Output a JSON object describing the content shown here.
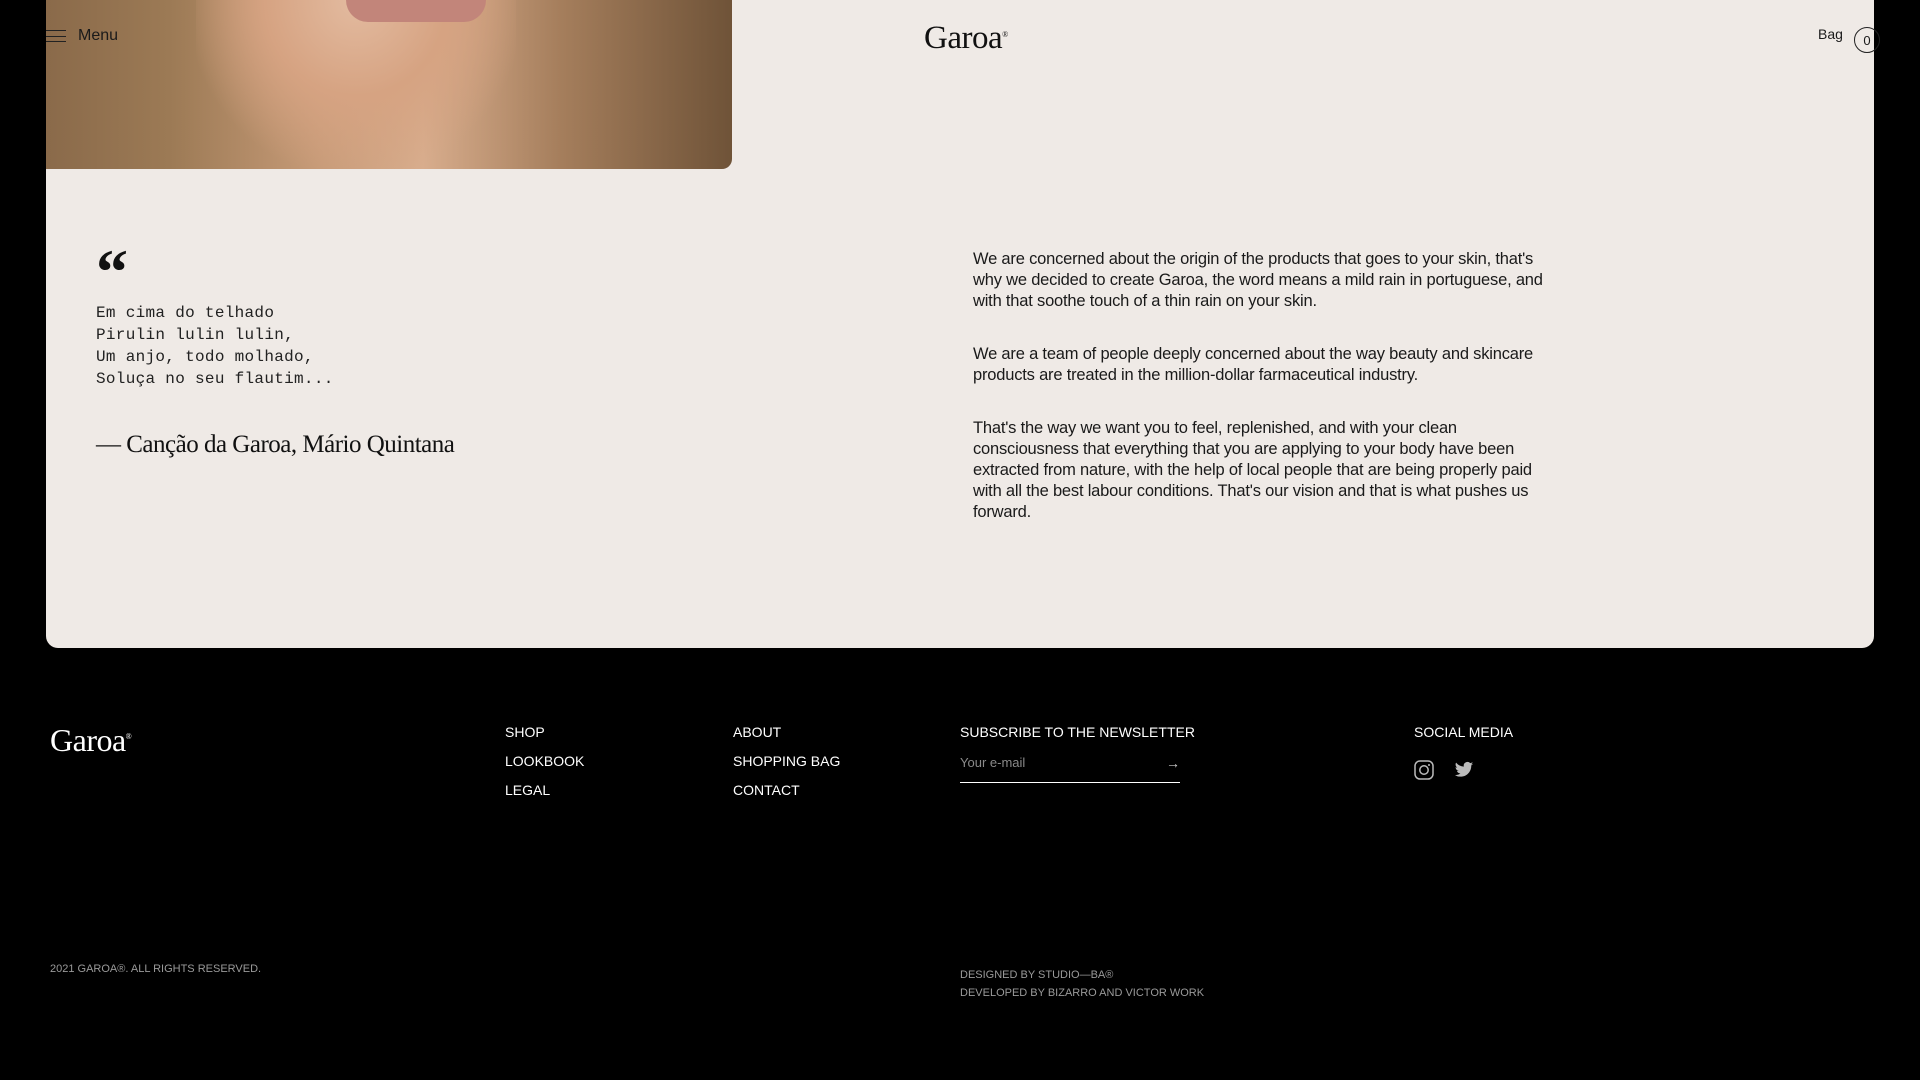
{
  "header": {
    "menu_label": "Menu",
    "logo": "Garoa",
    "logo_mark": "®",
    "bag_label": "Bag",
    "bag_count": "0"
  },
  "quote": {
    "mark": "“",
    "lines": [
      "Em cima do telhado",
      "Pirulin lulin lulin,",
      "Um anjo, todo molhado,",
      "Soluça no seu flautim..."
    ],
    "attribution": "— Canção da Garoa, Mário Quintana"
  },
  "about": {
    "paragraphs": [
      "We are concerned about the origin of the products that goes to your skin, that's why we decided to create Garoa, the word means a mild rain in portuguese, and with that soothe touch of a thin rain on your skin.",
      "We are a team of people deeply concerned about the way beauty and skincare products are treated in the million-dollar farmaceutical industry.",
      "That's the way we want you to feel, replenished, and with your clean consciousness that everything that you are applying to your body have been extracted from nature, with the help of local people that are being properly paid with all the best labour conditions. That's our vision and that is what pushes us forward."
    ]
  },
  "footer": {
    "logo": "Garoa",
    "logo_mark": "®",
    "col1": [
      "SHOP",
      "LOOKBOOK",
      "LEGAL"
    ],
    "col2": [
      "ABOUT",
      "SHOPPING BAG",
      "CONTACT"
    ],
    "newsletter_title": "SUBSCRIBE TO THE NEWSLETTER",
    "newsletter_placeholder": "Your e-mail",
    "social_title": "SOCIAL MEDIA",
    "social_icons": [
      "instagram-icon",
      "twitter-icon"
    ],
    "copyright": "2021 GAROA®. ALL RIGHTS RESERVED.",
    "designed_by": "DESIGNED BY STUDIO—BA®",
    "developed_by": "DEVELOPED BY BIZARRO AND VICTOR WORK"
  }
}
